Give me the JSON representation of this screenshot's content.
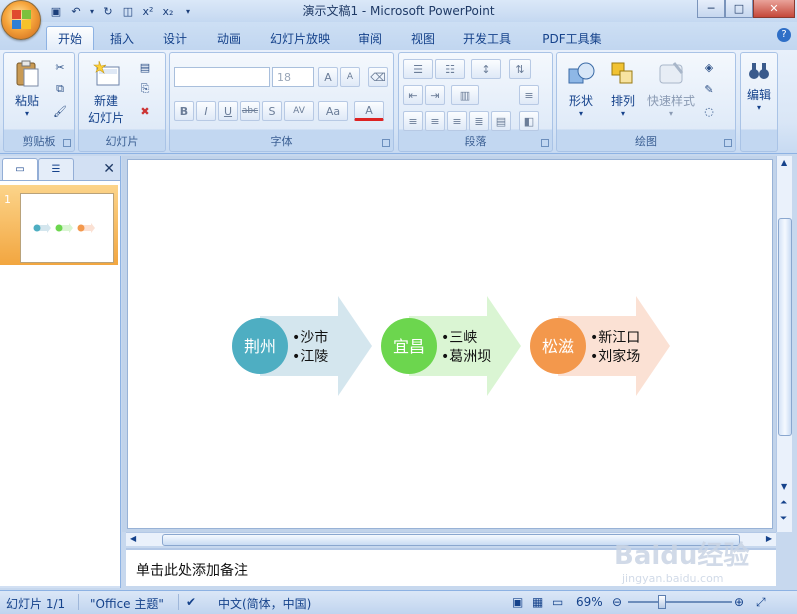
{
  "window": {
    "title": "演示文稿1 - Microsoft PowerPoint",
    "minimize_glyph": "─",
    "maximize_glyph": "□",
    "close_glyph": "✕"
  },
  "qat": [
    "save-icon",
    "undo-icon",
    "redo-icon",
    "print-preview-icon",
    "superscript-icon",
    "subscript-icon",
    "customize-icon"
  ],
  "tabs": [
    "开始",
    "插入",
    "设计",
    "动画",
    "幻灯片放映",
    "审阅",
    "视图",
    "开发工具",
    "PDF工具集"
  ],
  "active_tab": "开始",
  "ribbon": {
    "clipboard": {
      "label": "剪贴板",
      "paste": "粘贴"
    },
    "slides": {
      "label": "幻灯片",
      "new_slide": "新建",
      "new_slide_line2": "幻灯片"
    },
    "font": {
      "label": "字体",
      "font_size": "18",
      "bold": "B",
      "italic": "I",
      "underline": "U",
      "strike": "abc",
      "shadow": "S",
      "spacing": "AV",
      "case": "Aa",
      "color": "A",
      "grow": "A",
      "shrink": "A"
    },
    "paragraph": {
      "label": "段落"
    },
    "drawing": {
      "label": "绘图",
      "shapes": "形状",
      "arrange": "排列",
      "quick_styles": "快速样式"
    },
    "editing": {
      "label": "编辑"
    }
  },
  "left_pane": {
    "slide_number": "1",
    "close_glyph": "✕"
  },
  "slide": {
    "items": [
      {
        "city": "荆州",
        "bullets": [
          "沙市",
          "江陵"
        ]
      },
      {
        "city": "宜昌",
        "bullets": [
          "三峡",
          "葛洲坝"
        ]
      },
      {
        "city": "松滋",
        "bullets": [
          "新江口",
          "刘家场"
        ]
      }
    ]
  },
  "notes": {
    "placeholder": "单击此处添加备注"
  },
  "status": {
    "slide_counter": "幻灯片 1/1",
    "theme": "\"Office 主题\"",
    "language": "中文(简体，中国)",
    "zoom": "69%"
  },
  "watermark": {
    "text": "Baidu经验",
    "subtext": "jingyan.baidu.com"
  },
  "colors": {
    "circle_1": "#4eaec2",
    "arrow_1": "#d4e6ee",
    "circle_2": "#6cd64e",
    "arrow_2": "#daf5d3",
    "circle_3": "#f3984c",
    "arrow_3": "#fbe1d4"
  }
}
